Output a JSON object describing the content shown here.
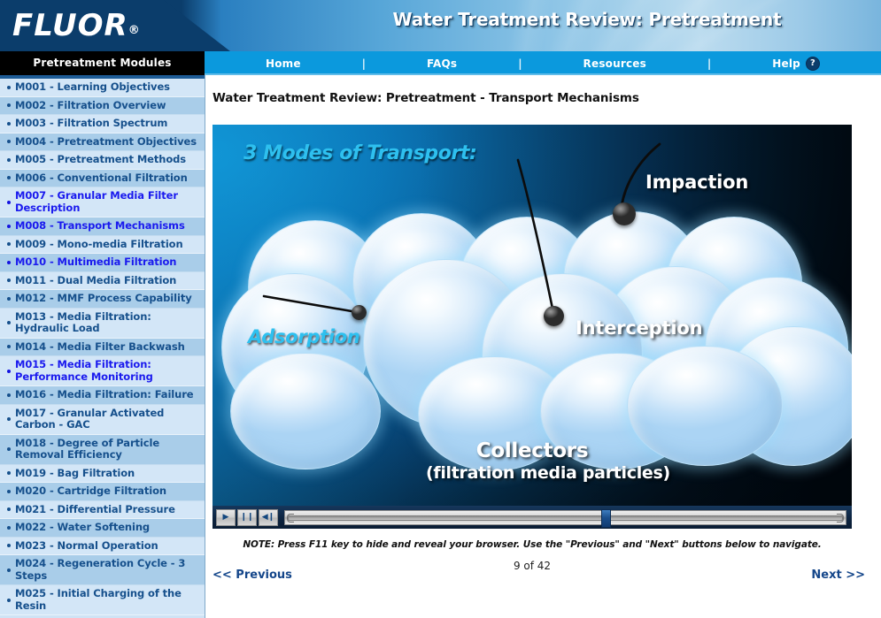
{
  "brand": {
    "logo_text": "FLUOR",
    "registered_mark": "®"
  },
  "banner": {
    "title": "Water Treatment Review: Pretreatment"
  },
  "nav": {
    "sidebar_tab_label": "Pretreatment Modules",
    "separator": "|",
    "items": [
      {
        "label": "Home"
      },
      {
        "label": "FAQs"
      },
      {
        "label": "Resources"
      },
      {
        "label": "Help",
        "icon": "question-mark-icon",
        "icon_glyph": "?"
      }
    ]
  },
  "sidebar": {
    "items": [
      {
        "label": "M001 - Learning Objectives",
        "visited": false
      },
      {
        "label": "M002 - Filtration Overview",
        "visited": false
      },
      {
        "label": "M003 - Filtration Spectrum",
        "visited": false
      },
      {
        "label": "M004 - Pretreatment Objectives",
        "visited": false
      },
      {
        "label": "M005 - Pretreatment Methods",
        "visited": false
      },
      {
        "label": "M006 - Conventional Filtration",
        "visited": false
      },
      {
        "label": "M007 - Granular Media Filter Description",
        "visited": true
      },
      {
        "label": "M008 - Transport Mechanisms",
        "visited": true
      },
      {
        "label": "M009 - Mono-media Filtration",
        "visited": false
      },
      {
        "label": "M010 - Multimedia Filtration",
        "visited": true
      },
      {
        "label": "M011 - Dual Media Filtration",
        "visited": false
      },
      {
        "label": "M012 - MMF Process Capability",
        "visited": false
      },
      {
        "label": "M013 - Media Filtration: Hydraulic Load",
        "visited": false
      },
      {
        "label": "M014 - Media Filter Backwash",
        "visited": false
      },
      {
        "label": "M015 - Media Filtration: Performance Monitoring",
        "visited": true
      },
      {
        "label": "M016 - Media Filtration: Failure",
        "visited": false
      },
      {
        "label": "M017 - Granular Activated Carbon - GAC",
        "visited": false
      },
      {
        "label": "M018 - Degree of Particle Removal Efficiency",
        "visited": false
      },
      {
        "label": "M019 - Bag Filtration",
        "visited": false
      },
      {
        "label": "M020 - Cartridge Filtration",
        "visited": false
      },
      {
        "label": "M021 - Differential Pressure",
        "visited": false
      },
      {
        "label": "M022 - Water Softening",
        "visited": false
      },
      {
        "label": "M023 - Normal Operation",
        "visited": false
      },
      {
        "label": "M024 - Regeneration Cycle - 3 Steps",
        "visited": false
      },
      {
        "label": "M025 - Initial Charging of the Resin",
        "visited": false
      }
    ]
  },
  "main": {
    "page_title": "Water Treatment Review: Pretreatment - Transport Mechanisms"
  },
  "stage": {
    "title": "3 Modes of Transport:",
    "labels": {
      "adsorption": "Adsorption",
      "interception": "Interception",
      "impaction": "Impaction",
      "collectors_line1": "Collectors",
      "collectors_line2": "(filtration media particles)"
    },
    "colors": {
      "title_cyan": "#2ec0ef",
      "label_white": "#ffffff",
      "stage_bg_left": "#1196d6",
      "stage_bg_right": "#010a12",
      "collector_fill": "#d5ebfb",
      "particle_fill": "#575757"
    }
  },
  "player": {
    "controls": [
      {
        "name": "play-button",
        "glyph": "▶"
      },
      {
        "name": "pause-button",
        "glyph": "❙❙"
      },
      {
        "name": "mute-button",
        "glyph": "◀❙"
      }
    ],
    "progress_percent": 57
  },
  "footer": {
    "note": "NOTE: Press F11 key to hide and reveal your browser. Use the \"Previous\" and \"Next\" buttons below to navigate.",
    "page_indicator": "9 of 42",
    "previous_label": "<< Previous",
    "next_label": "Next >>"
  },
  "theme": {
    "banner_navy": "#0b3d6b",
    "nav_blue": "#0b99dd",
    "sidebar_light": "#d3e6f7",
    "sidebar_alt": "#a9cde9",
    "link_navy": "#16508c",
    "link_visited": "#1a1aee",
    "footer_link": "#14468a"
  }
}
